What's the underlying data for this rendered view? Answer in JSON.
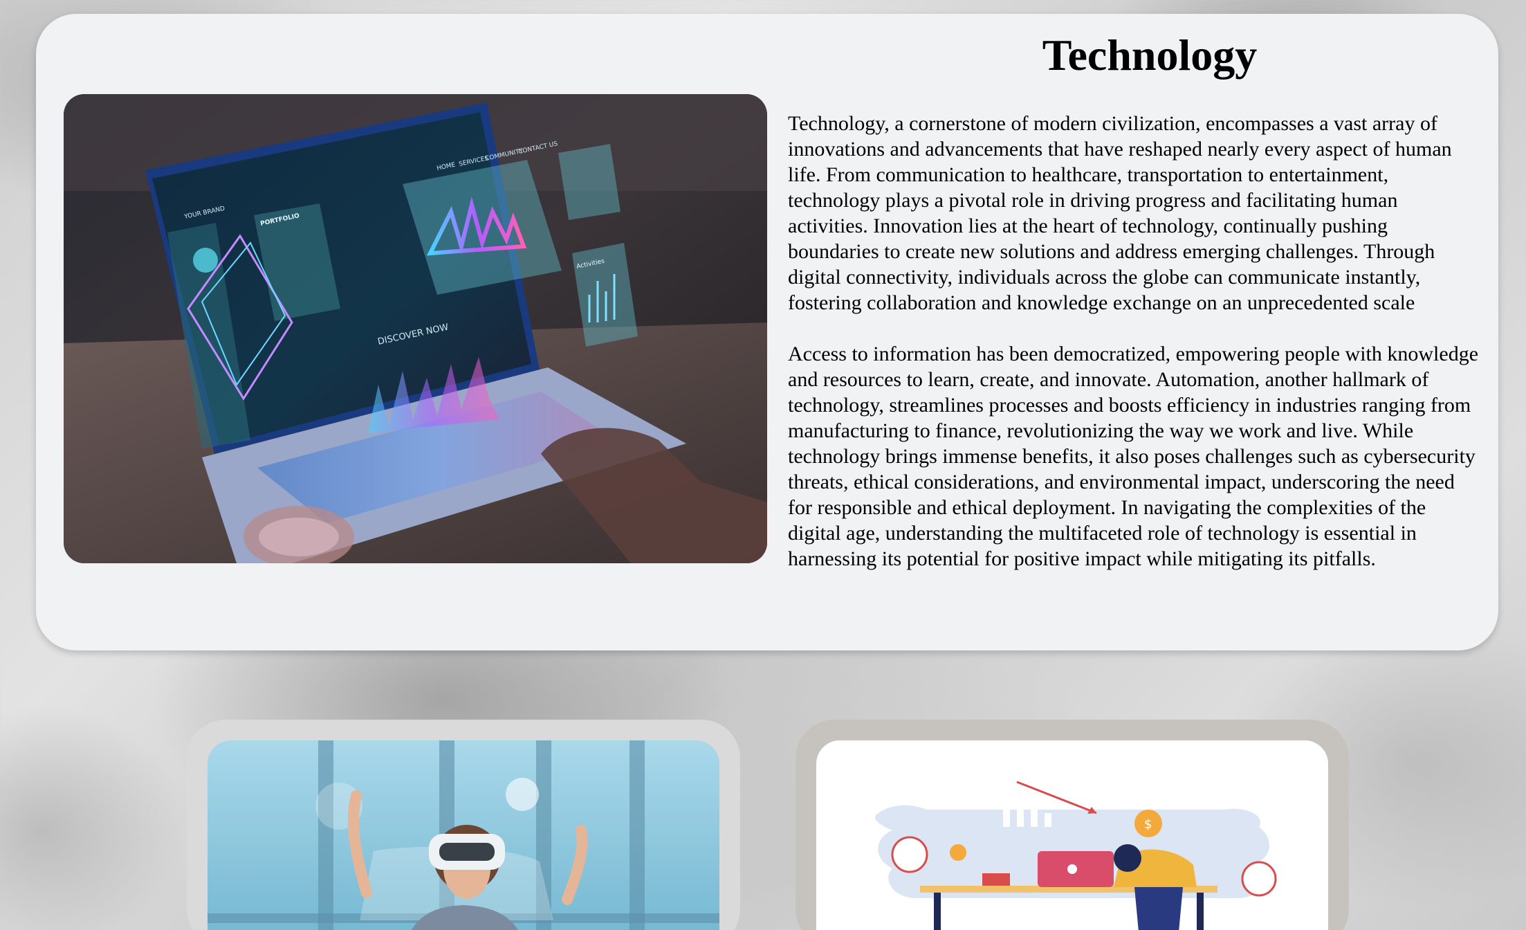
{
  "article": {
    "title": "Technology",
    "paragraphs": [
      "Technology, a cornerstone of modern civilization, encompasses a vast array of innovations and advancements that have reshaped nearly every aspect of human life. From communication to healthcare, transportation to entertainment, technology plays a pivotal role in driving progress and facilitating human activities. Innovation lies at the heart of technology, continually pushing boundaries to create new solutions and address emerging challenges. Through digital connectivity, individuals across the globe can communicate instantly, fostering collaboration and knowledge exchange on an unprecedented scale",
      "Access to information has been democratized, empowering people with knowledge and resources to learn, create, and innovate. Automation, another hallmark of technology, streamlines processes and boosts efficiency in industries ranging from manufacturing to finance, revolutionizing the way we work and live. While technology brings immense benefits, it also poses challenges such as cybersecurity threats, ethical considerations, and environmental impact, underscoring the need for responsible and ethical deployment. In navigating the complexities of the digital age, understanding the multifaceted role of technology is essential in harnessing its potential for positive impact while mitigating its pitfalls."
    ]
  },
  "hero_image": {
    "screen_nav": [
      "HOME",
      "SERVICES",
      "COMMUNITY",
      "CONTACT US"
    ],
    "screen_brand": "YOUR BRAND",
    "screen_panel_title": "PORTFOLIO",
    "screen_cta": "DISCOVER NOW",
    "screen_widget_title": "Activities"
  },
  "colors": {
    "card_background": "#f1f2f4",
    "page_background": "#d6d6d6",
    "left_card_frame": "#dadada",
    "right_card_frame": "#c6c3bf"
  }
}
